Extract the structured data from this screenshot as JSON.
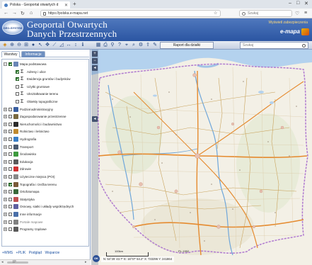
{
  "browser": {
    "tab_title": "Polska - Geoportal otwartych d",
    "url": "https://polska.e-mapa.net",
    "search_placeholder": "Szukaj"
  },
  "header": {
    "title_line1": "Geoportal Otwartych",
    "title_line2": "Danych Przestrzennych",
    "logo_text": "GEO-SYSTEM",
    "top_right_link": "Wyświetl zabezpieczenia",
    "brand": "e-mapa"
  },
  "toolbar": {
    "report_button": "Raport dla działki",
    "search_placeholder": "Szukaj"
  },
  "panel": {
    "tabs": [
      "Warstwy",
      "Informacje"
    ],
    "layers": [
      {
        "label": "Mapa podstawowa",
        "level": 0,
        "checked": true,
        "expanded": true,
        "icon": "basemap-icon",
        "color": "#6a86b6"
      },
      {
        "label": "Adresy i ulice",
        "level": 1,
        "checked": true,
        "icon": "sigma-icon",
        "color": "#555555"
      },
      {
        "label": "Ewidencja gruntów i budynków",
        "level": 1,
        "checked": true,
        "icon": "sigma-icon",
        "color": "#555555"
      },
      {
        "label": "Użytki gruntowe",
        "level": 1,
        "checked": false,
        "icon": "sigma-icon",
        "color": "#555555"
      },
      {
        "label": "Ukształtowanie terenu",
        "level": 1,
        "checked": false,
        "icon": "sigma-icon",
        "color": "#555555"
      },
      {
        "label": "Obiekty topograficzne",
        "level": 1,
        "checked": false,
        "icon": "sigma-icon",
        "color": "#555555"
      },
      {
        "label": "Podział administracyjny",
        "level": 0,
        "checked": false,
        "icon": "admin-icon",
        "color": "#3a5fa0"
      },
      {
        "label": "Zagospodarowanie przestrzenne",
        "level": 0,
        "checked": false,
        "icon": "planning-icon",
        "color": "#7a6a40"
      },
      {
        "label": "Nieruchomości i budownictwo",
        "level": 0,
        "checked": false,
        "icon": "building-icon",
        "color": "#2b2b2b"
      },
      {
        "label": "Rolnictwo i leśnictwo",
        "level": 0,
        "checked": false,
        "icon": "agriculture-icon",
        "color": "#c08a30"
      },
      {
        "label": "Hydrografia",
        "level": 0,
        "checked": false,
        "icon": "water-icon",
        "color": "#3a7fc8"
      },
      {
        "label": "Transport",
        "level": 0,
        "checked": false,
        "icon": "transport-icon",
        "color": "#4a5a70"
      },
      {
        "label": "Środowisko",
        "level": 0,
        "checked": false,
        "icon": "environment-icon",
        "color": "#3d9a3d"
      },
      {
        "label": "Edukacja",
        "level": 0,
        "checked": false,
        "icon": "education-icon",
        "color": "#5a5a5a"
      },
      {
        "label": "Zdrowie",
        "level": 0,
        "checked": false,
        "icon": "health-icon",
        "color": "#d03030"
      },
      {
        "label": "Użyteczne miejsca (POI)",
        "level": 0,
        "checked": false,
        "icon": "poi-icon",
        "color": "#888888"
      },
      {
        "label": "Topografia i rzeźba terenu",
        "level": 0,
        "checked": true,
        "icon": "topography-icon",
        "color": "#7a5a3a"
      },
      {
        "label": "Ortofotomapa",
        "level": 0,
        "checked": false,
        "icon": "orthophoto-icon",
        "color": "#3a6a3a"
      },
      {
        "label": "Statystyka",
        "level": 0,
        "checked": false,
        "icon": "statistics-icon",
        "color": "#c05050"
      },
      {
        "label": "Osnowy, siatki i układy współrzędnych",
        "level": 0,
        "checked": false,
        "icon": "grid-icon",
        "color": "#6060a0"
      },
      {
        "label": "Inne informacje",
        "level": 0,
        "checked": false,
        "icon": "info-icon",
        "color": "#4a6fa8"
      },
      {
        "label": "Portale mapowe",
        "level": 0,
        "checked": false,
        "icon": "portal-icon",
        "color": "#808080",
        "dim": true
      },
      {
        "label": "Programy rządowe",
        "level": 0,
        "checked": false,
        "icon": "government-icon",
        "color": "#5a5a5a"
      }
    ],
    "bottom_links": [
      "+WMS",
      "+PLIK",
      "Podgląd",
      "Wsparcie"
    ],
    "scroll_label": "IP"
  },
  "map": {
    "scale_label": "100km",
    "crs_label": "PL-1992",
    "coords": "N: 54°25' 43.7\"   E: 16°07' 54.2\"   X: 733296   Y: 241864",
    "ok_label": "OK"
  },
  "colors": {
    "header_blue": "#2b55a2",
    "brand_orange": "#e8a000",
    "checked_green": "#1f7a1f"
  }
}
